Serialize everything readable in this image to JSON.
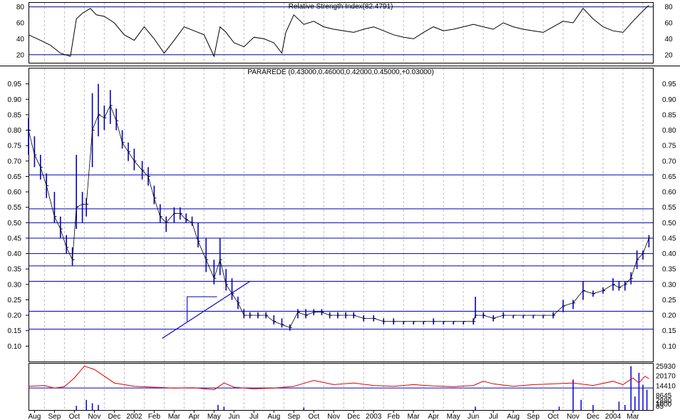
{
  "rsi_panel": {
    "title": "Relative Strength Index(82.4791)",
    "ylim": [
      10,
      85
    ],
    "ticks": [
      20,
      40,
      60,
      80
    ],
    "levels": [
      20,
      80
    ],
    "line_color": "#000000",
    "level_color": "#0000a0"
  },
  "price_panel": {
    "title": "PARAREDE (0.43000,0.46000,0.42000,0.45000,+0.03000)",
    "ylim": [
      0.05,
      1.0
    ],
    "ticks": [
      0.1,
      0.15,
      0.2,
      0.25,
      0.3,
      0.35,
      0.4,
      0.45,
      0.5,
      0.55,
      0.6,
      0.65,
      0.7,
      0.75,
      0.8,
      0.85,
      0.9,
      0.95
    ],
    "tick_labels": [
      "0.10",
      "0.15",
      "0.20",
      "0.25",
      "0.30",
      "0.35",
      "0.40",
      "0.45",
      "0.50",
      "0.55",
      "0.60",
      "0.65",
      "0.70",
      "0.75",
      "0.80",
      "0.85",
      "0.90",
      "0.95"
    ],
    "horizontal_lines": [
      0.155,
      0.213,
      0.31,
      0.36,
      0.4,
      0.45,
      0.5,
      0.545,
      0.655
    ],
    "trendline": {
      "from": [
        6.4,
        0.125
      ],
      "to": [
        10.8,
        0.31
      ]
    },
    "resistance_box": {
      "x0": 7.65,
      "x1": 9.15,
      "y": 0.26
    },
    "bar_color": "#0000c0",
    "line_color": "#0000c0"
  },
  "volume_panel": {
    "tick_labels": [
      "25930",
      "20170",
      "14410",
      "8645",
      "2880",
      "1000",
      "85"
    ],
    "volume_color": "#0000e0",
    "avg_color": "#e00000",
    "ref_line_color": "#0000c0"
  },
  "x_axis": {
    "labels": [
      "Aug",
      "Sep",
      "Oct",
      "Nov",
      "Dec",
      "2002",
      "Feb",
      "Mar",
      "Apr",
      "May",
      "Jun",
      "Jul",
      "Aug",
      "Sep",
      "Oct",
      "Nov",
      "Dec",
      "2003",
      "Feb",
      "Mar",
      "Apr",
      "May",
      "Jun",
      "Jul",
      "Aug",
      "Sep",
      "Oct",
      "Nov",
      "Dec",
      "2004",
      "Mar"
    ]
  },
  "chart_data": {
    "type": "line",
    "title": "PARAREDE (0.43000,0.46000,0.42000,0.45000,+0.03000)",
    "x_unit": "months since Aug 2001",
    "xlim": [
      -0.3,
      31.0
    ],
    "price_series": {
      "name": "PARAREDE",
      "x": [
        -0.3,
        0.0,
        0.3,
        0.6,
        1.0,
        1.3,
        1.6,
        1.9,
        2.1,
        2.4,
        2.6,
        2.9,
        3.2,
        3.5,
        3.8,
        4.1,
        4.4,
        4.7,
        5.0,
        5.4,
        5.7,
        6.0,
        6.3,
        6.6,
        7.0,
        7.3,
        7.6,
        7.9,
        8.2,
        8.6,
        9.0,
        9.3,
        9.6,
        9.9,
        10.2,
        10.5,
        10.8,
        11.2,
        11.6,
        12.0,
        12.4,
        12.8,
        13.2,
        13.6,
        14.0,
        14.4,
        14.8,
        15.2,
        15.6,
        16.0,
        16.5,
        17.0,
        17.5,
        18.0,
        18.5,
        19.0,
        19.5,
        20.0,
        20.5,
        21.0,
        21.5,
        22.0,
        22.1,
        22.5,
        23.0,
        23.5,
        24.0,
        24.5,
        25.0,
        25.5,
        26.0,
        26.5,
        27.0,
        27.5,
        28.0,
        28.5,
        29.0,
        29.3,
        29.6,
        29.9,
        30.2,
        30.5,
        30.8
      ],
      "high": [
        0.84,
        0.78,
        0.72,
        0.66,
        0.6,
        0.52,
        0.46,
        0.42,
        0.72,
        0.6,
        0.58,
        0.92,
        0.95,
        0.88,
        0.93,
        0.87,
        0.8,
        0.76,
        0.74,
        0.7,
        0.68,
        0.62,
        0.56,
        0.52,
        0.55,
        0.55,
        0.53,
        0.52,
        0.5,
        0.45,
        0.38,
        0.45,
        0.35,
        0.32,
        0.26,
        0.22,
        0.21,
        0.21,
        0.21,
        0.2,
        0.19,
        0.17,
        0.22,
        0.22,
        0.22,
        0.22,
        0.21,
        0.21,
        0.21,
        0.21,
        0.2,
        0.2,
        0.19,
        0.19,
        0.18,
        0.18,
        0.18,
        0.19,
        0.18,
        0.18,
        0.18,
        0.19,
        0.26,
        0.21,
        0.2,
        0.21,
        0.2,
        0.2,
        0.2,
        0.2,
        0.21,
        0.25,
        0.25,
        0.31,
        0.28,
        0.29,
        0.32,
        0.31,
        0.31,
        0.34,
        0.41,
        0.41,
        0.46
      ],
      "low": [
        0.72,
        0.68,
        0.64,
        0.58,
        0.5,
        0.45,
        0.4,
        0.36,
        0.48,
        0.5,
        0.52,
        0.68,
        0.78,
        0.8,
        0.82,
        0.8,
        0.74,
        0.7,
        0.67,
        0.64,
        0.62,
        0.56,
        0.5,
        0.47,
        0.5,
        0.51,
        0.5,
        0.49,
        0.42,
        0.34,
        0.3,
        0.33,
        0.28,
        0.25,
        0.22,
        0.19,
        0.19,
        0.19,
        0.19,
        0.17,
        0.16,
        0.15,
        0.19,
        0.19,
        0.2,
        0.2,
        0.19,
        0.19,
        0.19,
        0.19,
        0.18,
        0.18,
        0.17,
        0.17,
        0.17,
        0.17,
        0.17,
        0.17,
        0.17,
        0.17,
        0.17,
        0.17,
        0.19,
        0.19,
        0.18,
        0.19,
        0.19,
        0.19,
        0.19,
        0.19,
        0.19,
        0.21,
        0.22,
        0.25,
        0.26,
        0.27,
        0.28,
        0.28,
        0.28,
        0.3,
        0.35,
        0.38,
        0.42
      ],
      "close": [
        0.8,
        0.72,
        0.68,
        0.62,
        0.52,
        0.48,
        0.42,
        0.38,
        0.55,
        0.56,
        0.56,
        0.8,
        0.85,
        0.84,
        0.88,
        0.83,
        0.76,
        0.73,
        0.7,
        0.67,
        0.65,
        0.58,
        0.52,
        0.5,
        0.53,
        0.53,
        0.51,
        0.5,
        0.44,
        0.38,
        0.32,
        0.38,
        0.3,
        0.27,
        0.24,
        0.2,
        0.2,
        0.2,
        0.2,
        0.18,
        0.17,
        0.16,
        0.21,
        0.2,
        0.21,
        0.21,
        0.2,
        0.2,
        0.2,
        0.2,
        0.19,
        0.19,
        0.18,
        0.18,
        0.18,
        0.18,
        0.18,
        0.18,
        0.18,
        0.18,
        0.18,
        0.18,
        0.2,
        0.2,
        0.19,
        0.2,
        0.2,
        0.2,
        0.2,
        0.2,
        0.2,
        0.23,
        0.24,
        0.28,
        0.27,
        0.28,
        0.3,
        0.29,
        0.3,
        0.32,
        0.38,
        0.4,
        0.45
      ]
    },
    "rsi_series": {
      "name": "Relative Strength Index",
      "x": [
        -0.3,
        0.3,
        0.8,
        1.3,
        1.8,
        2.1,
        2.4,
        2.8,
        3.1,
        3.5,
        4.0,
        4.5,
        5.0,
        5.5,
        6.0,
        6.5,
        7.0,
        7.5,
        8.0,
        8.5,
        9.0,
        9.3,
        9.6,
        10.0,
        10.5,
        11.0,
        11.5,
        12.0,
        12.4,
        12.6,
        13.0,
        13.5,
        14.0,
        14.5,
        15.0,
        15.5,
        16.0,
        16.5,
        17.0,
        17.5,
        18.0,
        18.5,
        19.0,
        19.5,
        20.0,
        20.5,
        21.0,
        21.5,
        22.0,
        22.5,
        23.0,
        23.5,
        24.0,
        24.5,
        25.0,
        25.5,
        26.0,
        26.5,
        27.0,
        27.5,
        28.0,
        28.5,
        29.0,
        29.5,
        30.0,
        30.5,
        30.8
      ],
      "values": [
        45,
        38,
        32,
        22,
        18,
        65,
        72,
        78,
        70,
        68,
        60,
        45,
        38,
        55,
        40,
        22,
        38,
        55,
        50,
        45,
        18,
        55,
        48,
        35,
        30,
        42,
        40,
        35,
        22,
        48,
        70,
        58,
        62,
        55,
        52,
        50,
        48,
        52,
        55,
        50,
        45,
        42,
        40,
        48,
        55,
        50,
        52,
        55,
        58,
        55,
        52,
        60,
        55,
        52,
        50,
        48,
        55,
        62,
        60,
        78,
        65,
        55,
        50,
        48,
        62,
        75,
        82
      ]
    },
    "volume_series": {
      "name": "Volume",
      "x": [
        2.1,
        2.6,
        2.9,
        3.2,
        9.2,
        9.5,
        13.5,
        22.1,
        26.3,
        27.0,
        27.4,
        28.0,
        29.3,
        29.6,
        29.9,
        30.1,
        30.3,
        30.5,
        30.7
      ],
      "values": [
        2500,
        6000,
        4000,
        3000,
        3000,
        2000,
        1500,
        2000,
        2000,
        18000,
        6000,
        3000,
        5000,
        3000,
        25930,
        8000,
        22000,
        15000,
        12000
      ]
    },
    "volume_avg_series": {
      "name": "Volume average",
      "x": [
        -0.3,
        0.5,
        1.0,
        1.5,
        2.0,
        2.5,
        3.0,
        3.5,
        4.0,
        4.5,
        5.0,
        6.0,
        7.0,
        8.0,
        9.0,
        9.5,
        10.0,
        11.0,
        12.0,
        13.0,
        14.0,
        15.0,
        16.0,
        17.0,
        18.0,
        19.0,
        20.0,
        21.0,
        22.0,
        22.5,
        23.0,
        24.0,
        25.0,
        26.0,
        27.0,
        28.0,
        29.0,
        29.5,
        30.0,
        30.3,
        30.6,
        30.8
      ],
      "values": [
        14000,
        14500,
        13000,
        13800,
        19000,
        26000,
        24000,
        20000,
        16000,
        15000,
        14000,
        13500,
        13000,
        13200,
        12000,
        16000,
        13500,
        12500,
        13000,
        14000,
        17500,
        15000,
        16000,
        14500,
        14000,
        15000,
        14200,
        13800,
        14500,
        17000,
        15500,
        14000,
        15000,
        15500,
        16000,
        14500,
        17000,
        15000,
        19000,
        16000,
        20000,
        18500
      ]
    }
  }
}
